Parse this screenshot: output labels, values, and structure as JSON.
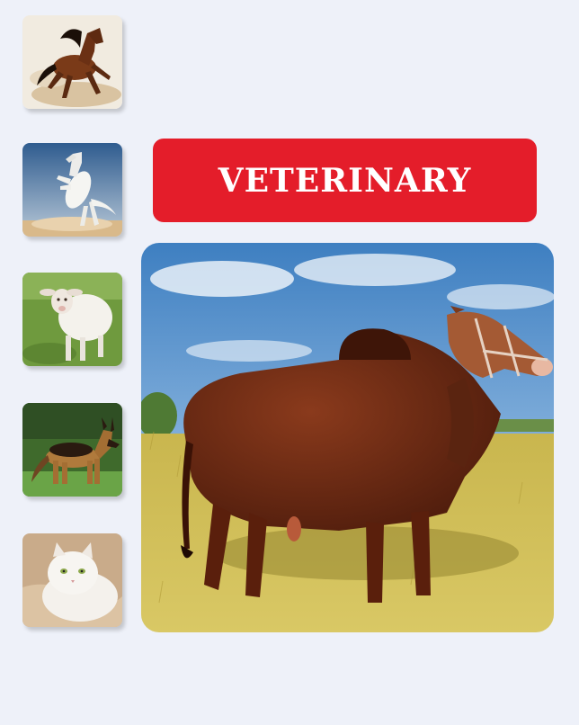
{
  "banner": {
    "title": "VETERINARY",
    "background_color": "#e41d2a",
    "text_color": "#ffffff"
  },
  "thumbnails": [
    {
      "name": "brown-horse-running"
    },
    {
      "name": "white-horse-rearing"
    },
    {
      "name": "white-sheep"
    },
    {
      "name": "german-shepherd-dog"
    },
    {
      "name": "white-persian-cat"
    }
  ],
  "hero": {
    "name": "brahman-bull-in-field"
  },
  "colors": {
    "page_background": "#eef1f9",
    "accent": "#e41d2a"
  }
}
